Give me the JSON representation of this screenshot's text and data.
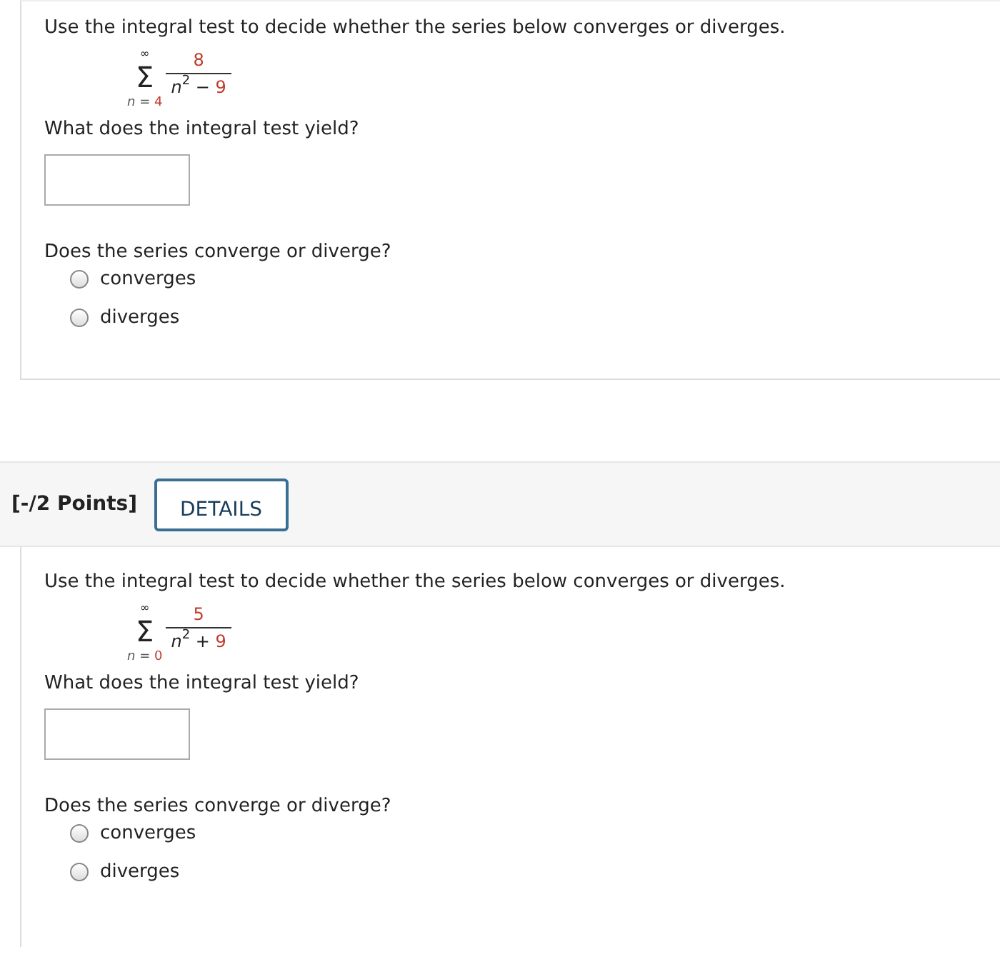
{
  "questions": [
    {
      "prompt": "Use the integral test to decide whether the series below converges or diverges.",
      "series": {
        "upper": "∞",
        "sign": "Σ",
        "index": "n =",
        "start": "4",
        "numerator": "8",
        "base": "n",
        "exponent": "2",
        "operator": "−",
        "constant": "9"
      },
      "ask": "What does the integral test yield?",
      "question2": "Does the series converge or diverge?",
      "options": [
        {
          "label": "converges",
          "selected": false
        },
        {
          "label": "diverges",
          "selected": false
        }
      ]
    },
    {
      "header": {
        "points": "[-/2 Points]",
        "button": "DETAILS"
      },
      "prompt": "Use the integral test to decide whether the series below converges or diverges.",
      "series": {
        "upper": "∞",
        "sign": "Σ",
        "index": "n =",
        "start": "0",
        "numerator": "5",
        "base": "n",
        "exponent": "2",
        "operator": "+",
        "constant": "9"
      },
      "ask": "What does the integral test yield?",
      "question2": "Does the series converge or diverge?",
      "options": [
        {
          "label": "converges",
          "selected": false
        },
        {
          "label": "diverges",
          "selected": false
        }
      ]
    }
  ]
}
